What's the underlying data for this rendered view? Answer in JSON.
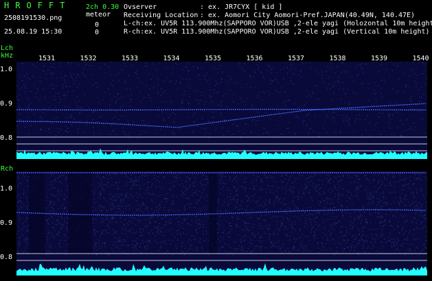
{
  "header": {
    "logo": "HROFFT",
    "channel_info": "2ch 0.30",
    "mode": "meteor",
    "filename": "2508191530.png",
    "datetime": "25.08.19 15:30",
    "count_l": "0",
    "count_r": "0",
    "observer_label": "Ovserver",
    "observer_value": ": ex. JR7CYX [ kid ]",
    "location_label": "Receiving Location",
    "location_value": ": ex. Aomori City Aomori-Pref.JAPAN(40.49N, 140.47E)",
    "lch_line": "L-ch:ex. UV5R 113.900Mhz(SAPPORO VOR)USB ,2-ele yagi (Holozontal 10m height",
    "rch_line": "R-ch:ex. UV5R 113.900Mhz(SAPPORO VOR)USB ,2-ele yagi (Vertical 10m height)"
  },
  "axes": {
    "lch_label": "Lch",
    "khz_label": "kHz",
    "rch_label": "Rch",
    "time_ticks": [
      "1531",
      "1532",
      "1533",
      "1534",
      "1535",
      "1536",
      "1537",
      "1538",
      "1539",
      "1540"
    ],
    "freq_ticks_l": [
      "1.0",
      "0.9",
      "0.8"
    ],
    "freq_ticks_r": [
      "1.0",
      "0.9",
      "0.8"
    ]
  },
  "colors": {
    "label_green": "#3cff3c",
    "background": "#000000",
    "waterfall_bg": "#0a0a3a",
    "trace": "#4a6bff",
    "noise": "#22ffff"
  }
}
